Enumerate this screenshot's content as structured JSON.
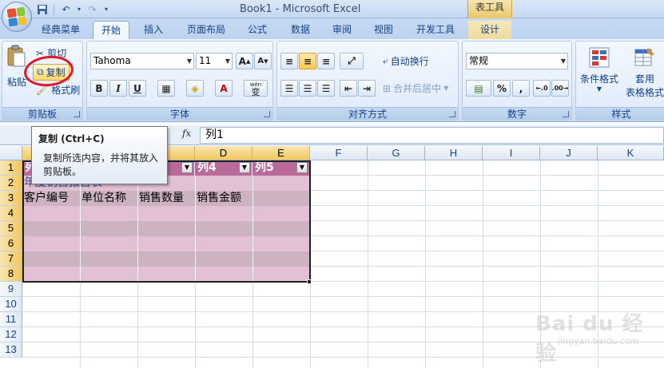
{
  "window": {
    "title": "Book1 - Microsoft Excel",
    "context_tab_title": "表工具"
  },
  "tabs": [
    {
      "label": "经典菜单"
    },
    {
      "label": "开始"
    },
    {
      "label": "插入"
    },
    {
      "label": "页面布局"
    },
    {
      "label": "公式"
    },
    {
      "label": "数据"
    },
    {
      "label": "审阅"
    },
    {
      "label": "视图"
    },
    {
      "label": "开发工具"
    },
    {
      "label": "设计"
    }
  ],
  "active_tab": "开始",
  "clipboard": {
    "paste_label": "粘贴",
    "cut_label": "剪切",
    "copy_label": "复制",
    "format_painter_label": "格式刷",
    "group_label": "剪贴板"
  },
  "font": {
    "font_name": "Tahoma",
    "font_size": "11",
    "grow_label": "A",
    "shrink_label": "A",
    "bold": "B",
    "italic": "I",
    "underline": "U",
    "font_color_label": "A",
    "phonetic_label": "wén",
    "phonetic_char": "变",
    "group_label": "字体"
  },
  "alignment": {
    "wrap_label": "自动换行",
    "merge_label": "合并后居中",
    "group_label": "对齐方式"
  },
  "number": {
    "format": "常规",
    "percent": "%",
    "comma": ",",
    "group_label": "数字"
  },
  "styles": {
    "conditional_label": "条件格式",
    "table_label_1": "套用",
    "table_label_2": "表格格式",
    "group_label": "样式"
  },
  "formula_bar": {
    "fx": "fx",
    "content": "列1"
  },
  "tooltip": {
    "title": "复制 (Ctrl+C)",
    "line1": "复制所选内容，并将其放入",
    "line2": "剪贴板。"
  },
  "grid": {
    "columns": [
      "D",
      "E",
      "F",
      "G",
      "H",
      "I",
      "J",
      "K"
    ],
    "rows": [
      "1",
      "2",
      "3",
      "4",
      "5",
      "6",
      "7",
      "8",
      "9",
      "10",
      "11",
      "12",
      "13"
    ],
    "table_headers": {
      "col4": "列4",
      "col5": "列5",
      "col1_partial": "列"
    },
    "filter_glyph": "▼",
    "row2_text": "年度销售报告表",
    "row3": [
      "客户编号",
      "单位名称",
      "销售数量",
      "销售金额"
    ]
  },
  "watermark": {
    "brand": "Bai du 经验",
    "url": "jingyan.baidu.com"
  },
  "colors": {
    "table_header": "#b86b98",
    "band_a": "#e3c1d5",
    "band_b": "#cdb3c2",
    "annotation_red": "#e0182a"
  }
}
